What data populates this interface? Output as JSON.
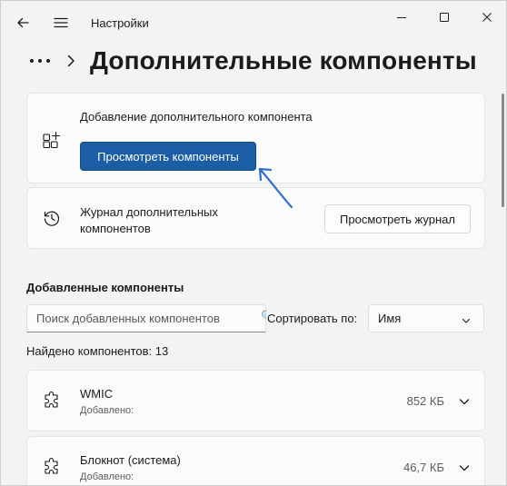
{
  "window": {
    "app_title": "Настройки"
  },
  "breadcrumb": {
    "title": "Дополнительные компоненты"
  },
  "add_card": {
    "text": "Добавление дополнительного компонента",
    "button_label": "Просмотреть компоненты"
  },
  "history_card": {
    "text": "Журнал дополнительных компонентов",
    "button_label": "Просмотреть журнал"
  },
  "installed": {
    "heading": "Добавленные компоненты",
    "search_placeholder": "Поиск добавленных компонентов",
    "sort_label": "Сортировать по:",
    "sort_value": "Имя",
    "found_text": "Найдено компонентов: 13",
    "items": [
      {
        "name": "WMIC",
        "status": "Добавлено:",
        "size": "852 КБ"
      },
      {
        "name": "Блокнот (система)",
        "status": "Добавлено:",
        "size": "46,7 КБ"
      }
    ]
  },
  "colors": {
    "accent": "#1b5ea6",
    "annotation_arrow": "#2f6fd6",
    "background": "#f3f3f3",
    "card": "#fbfbfb"
  },
  "icons": [
    "back-arrow-icon",
    "hamburger-menu-icon",
    "minimize-icon",
    "maximize-icon",
    "close-icon",
    "more-dots-icon",
    "chevron-right-icon",
    "add-grid-icon",
    "history-icon",
    "puzzle-icon",
    "chevron-down-icon"
  ]
}
